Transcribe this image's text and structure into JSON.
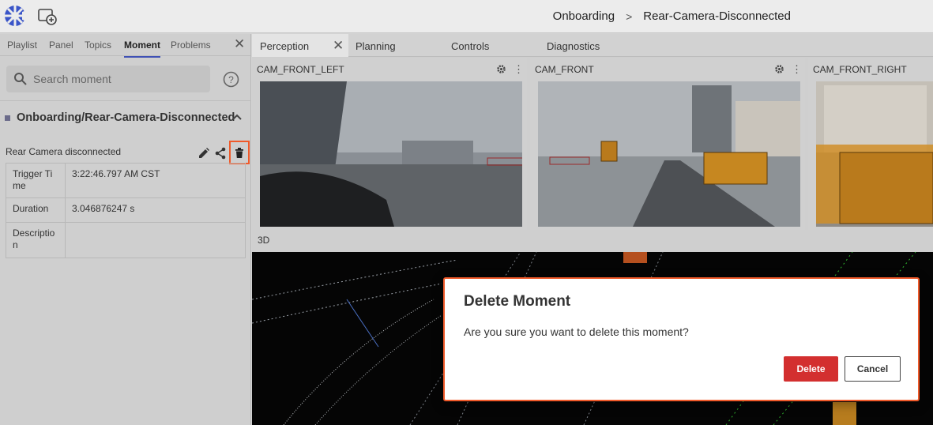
{
  "breadcrumb": {
    "first": "Onboarding",
    "separator": ">",
    "second": "Rear-Camera-Disconnected"
  },
  "left_tabs": [
    "Playlist",
    "Panel",
    "Topics",
    "Moment",
    "Problems"
  ],
  "left_tabs_active": "Moment",
  "search": {
    "placeholder": "Search moment"
  },
  "moment_group": {
    "title": "Onboarding/Rear-Camera-Disconnected"
  },
  "moment": {
    "name": "Rear Camera disconnected",
    "details": [
      {
        "key": "Trigger Time",
        "value": "3:22:46.797 AM CST"
      },
      {
        "key": "Duration",
        "value": "3.046876247 s"
      },
      {
        "key": "Description",
        "value": ""
      }
    ]
  },
  "right_tabs": [
    "Perception",
    "Planning",
    "Controls",
    "Diagnostics"
  ],
  "right_tabs_active": "Perception",
  "cameras": [
    "CAM_FRONT_LEFT",
    "CAM_FRONT",
    "CAM_FRONT_RIGHT"
  ],
  "viewport_label": "3D",
  "dialog": {
    "title": "Delete Moment",
    "message": "Are you sure you want to delete this moment?",
    "delete_label": "Delete",
    "cancel_label": "Cancel"
  },
  "colors": {
    "accent": "#3f51b5",
    "danger": "#d32f2f",
    "highlight": "#f05a2a"
  }
}
